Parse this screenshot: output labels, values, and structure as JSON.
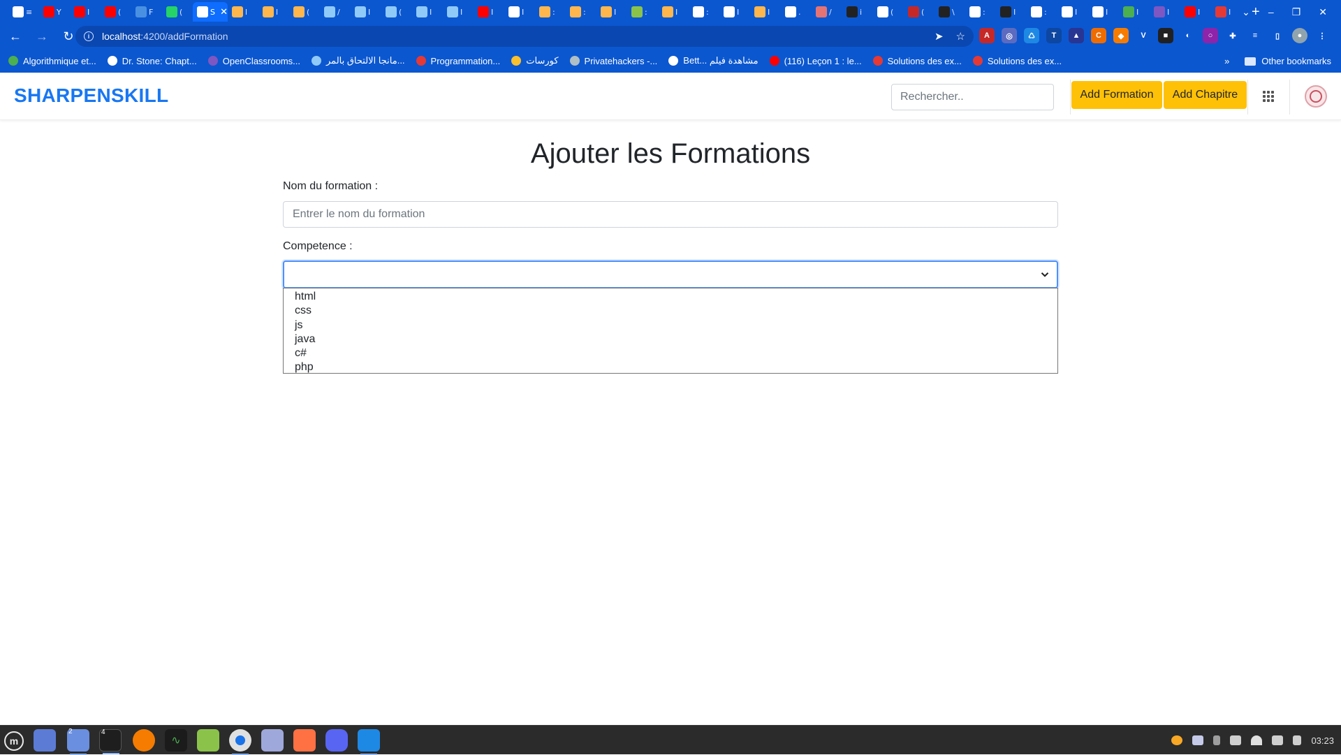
{
  "browser": {
    "tabs": [
      {
        "icon": "document-icon",
        "color": "#ffffff",
        "text": "≡"
      },
      {
        "icon": "youtube-icon",
        "color": "#ff0000",
        "text": "Y"
      },
      {
        "icon": "youtube-icon",
        "color": "#ff0000",
        "text": "I"
      },
      {
        "icon": "youtube-icon",
        "color": "#ff0000",
        "text": "("
      },
      {
        "icon": "site-icon",
        "color": "#4a90e2",
        "text": "F"
      },
      {
        "icon": "whatsapp-icon",
        "color": "#25d366",
        "text": "("
      },
      {
        "icon": "sharpenskill-icon",
        "color": "#ffffff",
        "text": "S",
        "active": true
      },
      {
        "icon": "site-icon",
        "color": "#ffb74d",
        "text": "l"
      },
      {
        "icon": "site-icon",
        "color": "#ffb74d",
        "text": "l"
      },
      {
        "icon": "site-icon",
        "color": "#ffb74d",
        "text": "("
      },
      {
        "icon": "site-icon",
        "color": "#90caf9",
        "text": "/"
      },
      {
        "icon": "site-icon",
        "color": "#90caf9",
        "text": "I"
      },
      {
        "icon": "site-icon",
        "color": "#90caf9",
        "text": "("
      },
      {
        "icon": "site-icon",
        "color": "#90caf9",
        "text": "I"
      },
      {
        "icon": "site-icon",
        "color": "#90caf9",
        "text": "I"
      },
      {
        "icon": "youtube-icon",
        "color": "#ff0000",
        "text": "I"
      },
      {
        "icon": "site-icon",
        "color": "#ffffff",
        "text": "I"
      },
      {
        "icon": "site-icon",
        "color": "#ffb74d",
        "text": ":"
      },
      {
        "icon": "site-icon",
        "color": "#ffb74d",
        "text": ":"
      },
      {
        "icon": "site-icon",
        "color": "#ffb74d",
        "text": "I"
      },
      {
        "icon": "site-icon",
        "color": "#8bc34a",
        "text": ":"
      },
      {
        "icon": "site-icon",
        "color": "#ffb74d",
        "text": "I"
      },
      {
        "icon": "google-icon",
        "color": "#ffffff",
        "text": ":"
      },
      {
        "icon": "site-icon",
        "color": "#ffffff",
        "text": "I"
      },
      {
        "icon": "site-icon",
        "color": "#ffb74d",
        "text": "I"
      },
      {
        "icon": "site-icon",
        "color": "#ffffff",
        "text": "."
      },
      {
        "icon": "site-icon",
        "color": "#e57373",
        "text": "/"
      },
      {
        "icon": "github-icon",
        "color": "#222222",
        "text": "i"
      },
      {
        "icon": "google-icon",
        "color": "#ffffff",
        "text": "("
      },
      {
        "icon": "site-icon",
        "color": "#c62828",
        "text": "("
      },
      {
        "icon": "site-icon",
        "color": "#222222",
        "text": "\\"
      },
      {
        "icon": "google-icon",
        "color": "#ffffff",
        "text": ":"
      },
      {
        "icon": "github-icon",
        "color": "#222222",
        "text": "I"
      },
      {
        "icon": "google-icon",
        "color": "#ffffff",
        "text": ":"
      },
      {
        "icon": "google-icon",
        "color": "#ffffff",
        "text": "I"
      },
      {
        "icon": "extension-icon",
        "color": "#ffffff",
        "text": "I"
      },
      {
        "icon": "site-icon",
        "color": "#4caf50",
        "text": "I"
      },
      {
        "icon": "site-icon",
        "color": "#7e57c2",
        "text": "I"
      },
      {
        "icon": "youtube-icon",
        "color": "#ff0000",
        "text": "I"
      },
      {
        "icon": "site-icon",
        "color": "#e53935",
        "text": "I"
      }
    ],
    "url_host": "localhost",
    "url_path": ":4200/addFormation",
    "bookmarks": [
      {
        "label": "Algorithmique et...",
        "color": "#4caf50"
      },
      {
        "label": "Dr. Stone: Chapt...",
        "color": "#ffffff"
      },
      {
        "label": "OpenClassrooms...",
        "color": "#7e57c2"
      },
      {
        "label": "مانجا الالتحاق بالمر...",
        "color": "#90caf9"
      },
      {
        "label": "Programmation...",
        "color": "#e53935"
      },
      {
        "label": "كورسات",
        "color": "#fbc02d"
      },
      {
        "label": "Privatehackers -...",
        "color": "#b0bec5"
      },
      {
        "label": "Bett... مشاهدة فيلم",
        "color": "#ffffff"
      },
      {
        "label": "(116) Leçon 1 : le...",
        "color": "#ff0000"
      },
      {
        "label": "Solutions des ex...",
        "color": "#e53935"
      },
      {
        "label": "Solutions des ex...",
        "color": "#e53935"
      }
    ],
    "other_bookmarks": "Other bookmarks",
    "more_bookmarks": "»"
  },
  "navbar": {
    "brand": "SHARPENSKILL",
    "search_placeholder": "Rechercher..",
    "add_formation": "Add Formation",
    "add_chapitre": "Add Chapitre"
  },
  "form": {
    "title": "Ajouter les Formations",
    "name_label": "Nom du formation :",
    "name_placeholder": "Entrer le nom du formation",
    "competence_label": "Competence :",
    "competence_value": "",
    "options": [
      "html",
      "css",
      "js",
      "java",
      "c#",
      "php"
    ]
  },
  "taskbar": {
    "clock": "03:23",
    "badges": {
      "files": "2",
      "terminal": "4"
    }
  }
}
